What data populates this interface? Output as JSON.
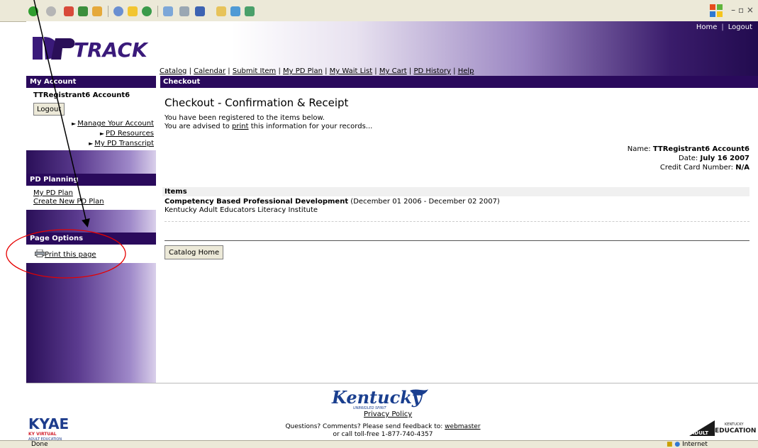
{
  "header": {
    "logo_text": "TRACK",
    "top_nav": [
      "Home",
      "Logout"
    ]
  },
  "main_nav": [
    "Catalog",
    "Calendar",
    "Submit Item",
    "My PD Plan",
    "My Wait List",
    "My Cart",
    "PD History",
    "Help"
  ],
  "sidebar": {
    "my_account": {
      "title": "My Account",
      "user": "TTRegistrant6 Account6",
      "logout_label": "Logout",
      "links": [
        "Manage Your Account",
        "PD Resources",
        "My PD Transcript"
      ]
    },
    "pd_planning": {
      "title": "PD Planning",
      "links": [
        "My PD Plan",
        "Create New PD Plan"
      ]
    },
    "page_options": {
      "title": "Page Options",
      "print_label": "Print this page"
    }
  },
  "content": {
    "section_title": "Checkout",
    "page_title": "Checkout - Confirmation & Receipt",
    "intro_line1": "You have been registered to the items below.",
    "intro_pre": "You are advised to ",
    "intro_link": "print",
    "intro_post": " this information for your records...",
    "receipt": {
      "name_label": "Name:",
      "name_value": "TTRegistrant6 Account6",
      "date_label": "Date:",
      "date_value": "July 16 2007",
      "cc_label": "Credit Card Number:",
      "cc_value": "N/A"
    },
    "items_header": "Items",
    "item": {
      "title": "Competency Based Professional Development",
      "dates": " (December 01 2006 - December 02 2007)",
      "org": "Kentucky Adult Educators Literacy Institute"
    },
    "catalog_home_label": "Catalog Home"
  },
  "footer": {
    "state_logo": "Kentucky",
    "state_tagline": "UNBRIDLED SPIRIT",
    "privacy": "Privacy Policy",
    "questions_pre": "Questions? Comments? Please send feedback to: ",
    "webmaster": "webmaster",
    "phone": "or call toll-free 1-877-740-4357",
    "left_logo": "KYAE",
    "left_logo_sub1": "KY VIRTUAL",
    "left_logo_sub2": "ADULT EDUCATION",
    "right_logo_line1": "KENTUCKY",
    "right_logo_line2": "ADULT",
    "right_logo_line3": "EDUCATION"
  },
  "statusbar": {
    "status": "Done",
    "zone": "Internet"
  },
  "colors": {
    "section_header": "#2a0a5c",
    "annotation": "#e60000"
  }
}
